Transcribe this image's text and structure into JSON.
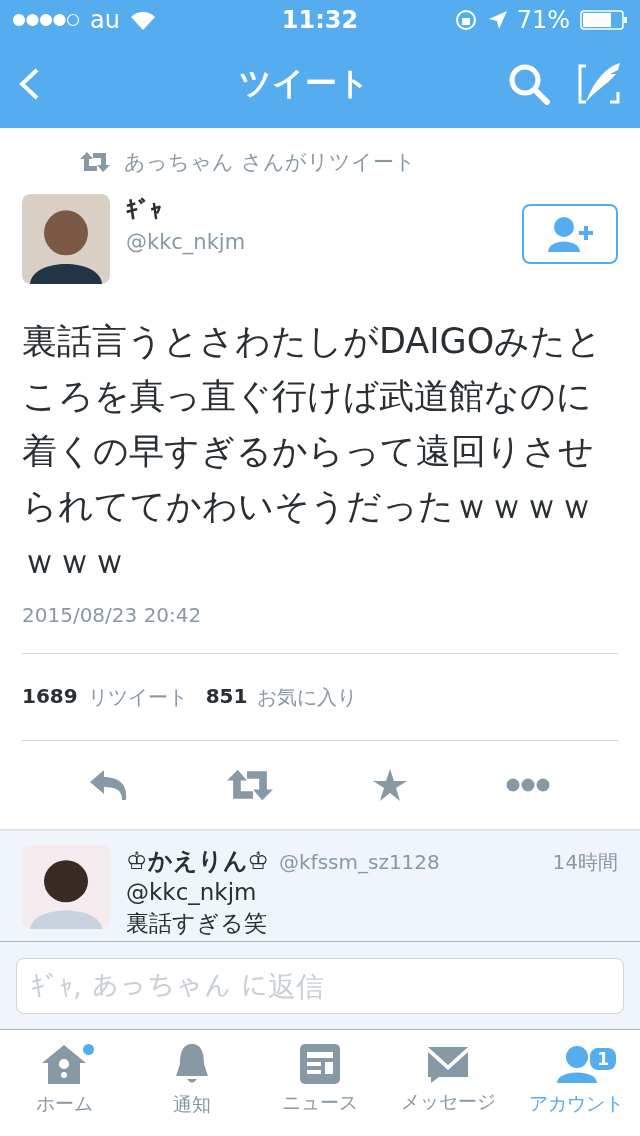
{
  "status_bar": {
    "carrier": "au",
    "time": "11:32",
    "battery": "71%"
  },
  "nav_bar": {
    "title": "ツイート"
  },
  "tweet": {
    "retweeted_by": "あっちゃん さんがリツイート",
    "name": "ｷﾞｬ",
    "handle": "@kkc_nkjm",
    "text": "裏話言うとさわたしがDAIGOみたところを真っ直ぐ行けば武道館なのに着くの早すぎるからって遠回りさせられててかわいそうだったｗｗｗｗｗｗｗ",
    "timestamp": "2015/08/23 20:42",
    "stats": [
      {
        "count": "1689",
        "label": "リツイート"
      },
      {
        "count": "851",
        "label": "お気に入り"
      }
    ]
  },
  "reply": {
    "name": "♔かえりん♔",
    "handle": "@kfssm_sz1128",
    "time": "14時間",
    "mention": "@kkc_nkjm",
    "text": "裏話すぎる笑"
  },
  "reply_box": {
    "placeholder": "ｷﾞｬ, あっちゃん に返信"
  },
  "tab_bar": [
    {
      "label": "ホーム",
      "kind": "home",
      "selected": false,
      "new": true
    },
    {
      "label": "通知",
      "kind": "bell",
      "selected": false,
      "new": false
    },
    {
      "label": "ニュース",
      "kind": "news",
      "selected": false,
      "new": false
    },
    {
      "label": "メッセージ",
      "kind": "mail",
      "selected": false,
      "new": false
    },
    {
      "label": "アカウント",
      "kind": "account",
      "selected": true,
      "new": false,
      "badge": "1"
    }
  ]
}
